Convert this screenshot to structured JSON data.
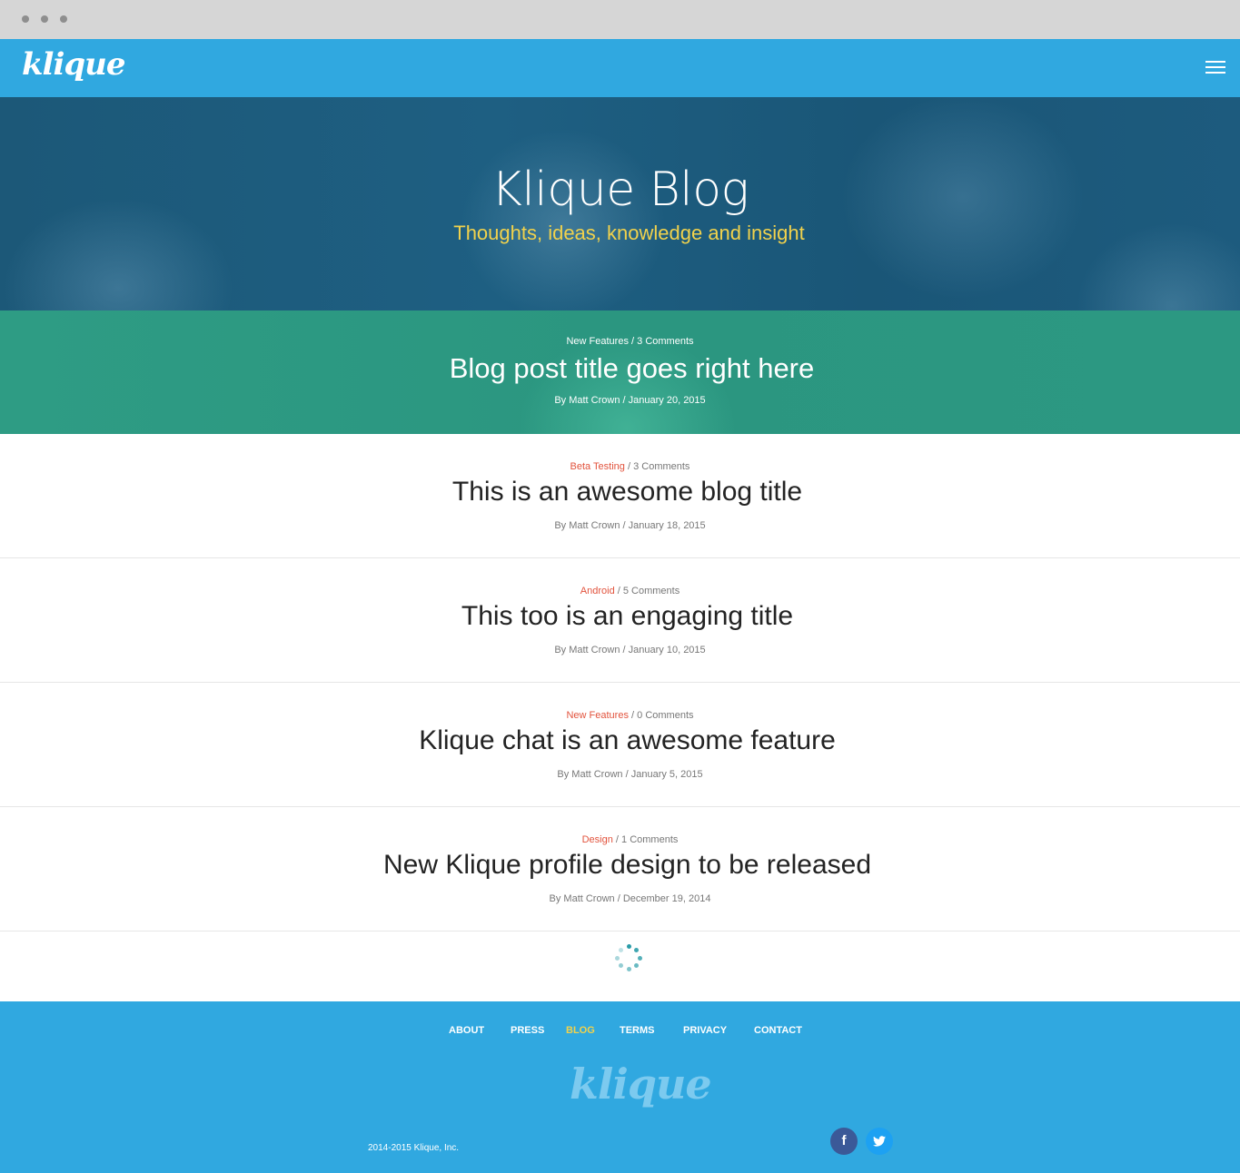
{
  "brand": {
    "logo": "klique"
  },
  "header": {
    "menu_icon": "hamburger-menu-icon"
  },
  "hero": {
    "title": "Klique Blog",
    "subtitle": "Thoughts, ideas, knowledge and insight"
  },
  "featured_post": {
    "category": "New Features",
    "comments": "3 Comments",
    "title": "Blog post title goes right here",
    "author": "By Matt Crown",
    "date": "January 20, 2015"
  },
  "posts": [
    {
      "category": "Beta Testing",
      "comments": "3 Comments",
      "title": "This is an awesome blog title",
      "author": "By Matt Crown",
      "date": "January 18, 2015"
    },
    {
      "category": "Android",
      "comments": "5 Comments",
      "title": "This too is an engaging title",
      "author": "By Matt Crown",
      "date": "January 10, 2015"
    },
    {
      "category": "New Features",
      "comments": "0 Comments",
      "title": "Klique chat is an awesome feature",
      "author": "By Matt Crown",
      "date": "January 5, 2015"
    },
    {
      "category": "Design",
      "comments": "1 Comments",
      "title": "New Klique profile design to be released",
      "author": "By Matt Crown",
      "date": "December 19, 2014"
    }
  ],
  "separator": "/",
  "loader": {
    "icon": "loading-spinner-icon"
  },
  "footer": {
    "nav": [
      {
        "label": "ABOUT"
      },
      {
        "label": "PRESS"
      },
      {
        "label": "BLOG",
        "active": true
      },
      {
        "label": "TERMS"
      },
      {
        "label": "PRIVACY"
      },
      {
        "label": "CONTACT"
      }
    ],
    "logo": "klique",
    "copyright": "2014-2015 Klique, Inc.",
    "social": [
      {
        "icon": "facebook-icon",
        "glyph": "f"
      },
      {
        "icon": "twitter-icon",
        "glyph": "t"
      }
    ]
  },
  "colors": {
    "brand_blue": "#30a8e0",
    "hero_overlay": "#1c5878",
    "featured_green": "#2e9c84",
    "accent_yellow": "#f1d24c",
    "category_red": "#e2533d",
    "facebook": "#3b5998",
    "twitter": "#1da1f2"
  }
}
